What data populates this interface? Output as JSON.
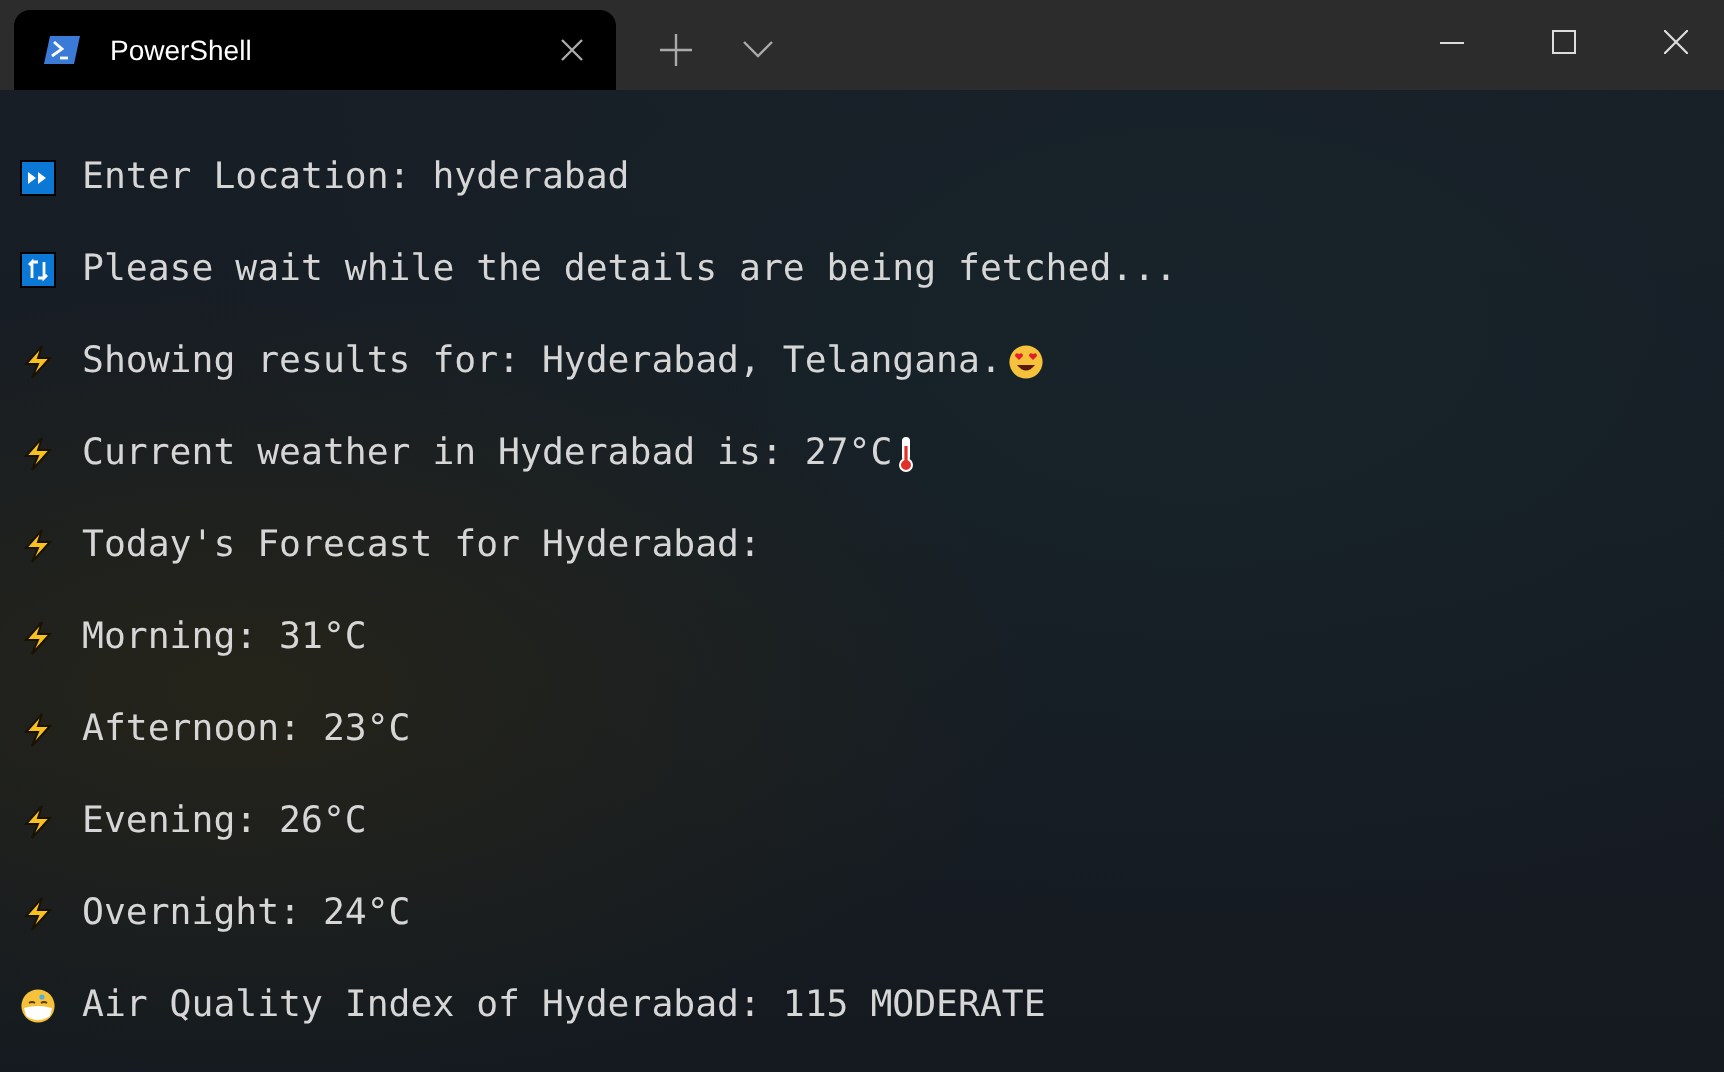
{
  "window": {
    "tab": {
      "title": "PowerShell",
      "selected": true
    }
  },
  "lines": [
    {
      "kind": "input",
      "text": "Enter Location: hyderabad"
    },
    {
      "kind": "progress",
      "text": "Please wait while the details are being fetched..."
    },
    {
      "kind": "location",
      "text": "Showing results for: Hyderabad, Telangana."
    },
    {
      "kind": "temperature",
      "text": "Current weather in Hyderabad is: 27°C"
    },
    {
      "kind": "result",
      "text": "Today's Forecast for Hyderabad:"
    },
    {
      "kind": "result",
      "text": "Morning: 31°C"
    },
    {
      "kind": "result",
      "text": "Afternoon: 23°C"
    },
    {
      "kind": "result",
      "text": "Evening: 26°C"
    },
    {
      "kind": "result",
      "text": "Overnight: 24°C"
    },
    {
      "kind": "air",
      "text": "Air Quality Index of Hyderabad: 115 MODERATE"
    }
  ]
}
